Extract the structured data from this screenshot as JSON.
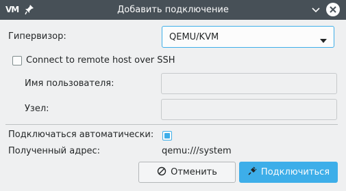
{
  "window": {
    "title": "Добавить подключение",
    "logo_text": "VM"
  },
  "form": {
    "hypervisor_label": "Гипервизор:",
    "hypervisor_value": "QEMU/KVM",
    "ssh_label": "Connect to remote host over SSH",
    "ssh_checked": false,
    "username_label": "Имя пользователя:",
    "username_value": "",
    "host_label": "Узел:",
    "host_value": "",
    "autoconnect_label": "Подключаться автоматически:",
    "autoconnect_checked": true,
    "uri_label": "Полученный адрес:",
    "uri_value": "qemu:///system"
  },
  "buttons": {
    "cancel_label": "Отменить",
    "connect_label": "Подключиться"
  },
  "colors": {
    "accent": "#3daee9",
    "titlebar": "#475057",
    "background": "#eff0f1"
  }
}
